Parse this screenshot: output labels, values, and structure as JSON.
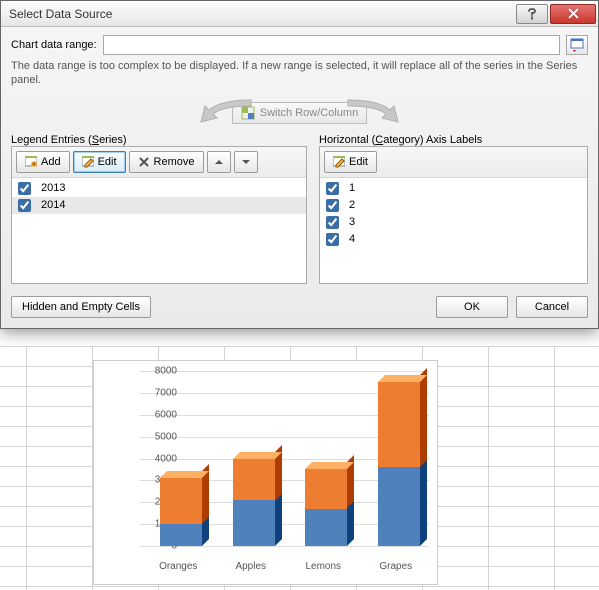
{
  "dialog": {
    "title": "Select Data Source",
    "range_label": "Chart data range:",
    "range_value": "",
    "hint": "The data range is too complex to be displayed. If a new range is selected, it will replace all of the series in the Series panel.",
    "switch_label": "Switch Row/Column",
    "series_header_pre": "Legend Entries (",
    "series_header_u": "S",
    "series_header_post": "eries)",
    "categories_header_pre": "Horizontal (",
    "categories_header_u": "C",
    "categories_header_post": "ategory) Axis Labels",
    "btn_add": "Add",
    "btn_edit": "Edit",
    "btn_remove": "Remove",
    "btn_edit2": "Edit",
    "series": [
      {
        "label": "2013",
        "checked": true
      },
      {
        "label": "2014",
        "checked": true
      }
    ],
    "categories": [
      {
        "label": "1",
        "checked": true
      },
      {
        "label": "2",
        "checked": true
      },
      {
        "label": "3",
        "checked": true
      },
      {
        "label": "4",
        "checked": true
      }
    ],
    "btn_hidden": "Hidden and Empty Cells",
    "btn_ok": "OK",
    "btn_cancel": "Cancel"
  },
  "chart_data": {
    "type": "bar",
    "stacked": true,
    "style": "3d",
    "categories": [
      "Oranges",
      "Apples",
      "Lemons",
      "Grapes"
    ],
    "series": [
      {
        "name": "2013",
        "color": "#4f81bd",
        "values": [
          1000,
          2100,
          1700,
          3600
        ]
      },
      {
        "name": "2014",
        "color": "#ed7d31",
        "values": [
          2100,
          1900,
          1800,
          3900
        ]
      }
    ],
    "ylim": [
      0,
      8000
    ],
    "yticks": [
      0,
      1000,
      2000,
      3000,
      4000,
      5000,
      6000,
      7000,
      8000
    ]
  }
}
